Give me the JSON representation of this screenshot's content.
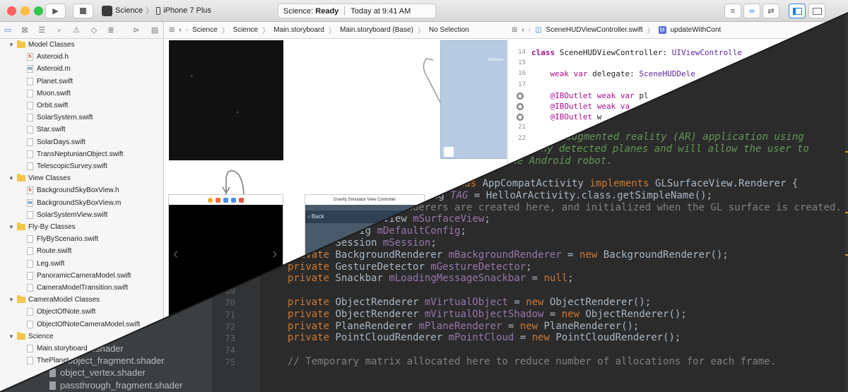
{
  "xcode": {
    "window_controls": {
      "close": "#fc605c",
      "minimize": "#fdbc40",
      "zoom": "#34c84a"
    },
    "scheme": {
      "target": "Science",
      "device": "iPhone 7 Plus",
      "separator": "〉"
    },
    "status": {
      "project": "Science:",
      "state": "Ready",
      "time": "Today at 9:41 AM"
    },
    "navigator": [
      {
        "type": "group",
        "label": "Model Classes"
      },
      {
        "type": "file",
        "kind": "h",
        "label": "Asteroid.h"
      },
      {
        "type": "file",
        "kind": "m",
        "label": "Asteroid.m"
      },
      {
        "type": "file",
        "kind": "swift",
        "label": "Planet.swift"
      },
      {
        "type": "file",
        "kind": "swift",
        "label": "Moon.swift"
      },
      {
        "type": "file",
        "kind": "swift",
        "label": "Orbit.swift"
      },
      {
        "type": "file",
        "kind": "swift",
        "label": "SolarSystem.swift"
      },
      {
        "type": "file",
        "kind": "swift",
        "label": "Star.swift"
      },
      {
        "type": "file",
        "kind": "swift",
        "label": "SolarDays.swift"
      },
      {
        "type": "file",
        "kind": "swift",
        "label": "TransNeptunianObject.swift"
      },
      {
        "type": "file",
        "kind": "swift",
        "label": "TelescopicSurvey.swift"
      },
      {
        "type": "group",
        "label": "View Classes"
      },
      {
        "type": "file",
        "kind": "h",
        "label": "BackgroundSkyBoxView.h"
      },
      {
        "type": "file",
        "kind": "m",
        "label": "BackgroundSkyBoxView.m"
      },
      {
        "type": "file",
        "kind": "swift",
        "label": "SolarSystemView.swift"
      },
      {
        "type": "group",
        "label": "Fly-By Classes"
      },
      {
        "type": "file",
        "kind": "swift",
        "label": "FlyByScenario.swift"
      },
      {
        "type": "file",
        "kind": "swift",
        "label": "Route.swift"
      },
      {
        "type": "file",
        "kind": "swift",
        "label": "Leg.swift"
      },
      {
        "type": "file",
        "kind": "swift",
        "label": "PanoramicCameraModel.swift"
      },
      {
        "type": "file",
        "kind": "swift",
        "label": "CameraModelTransition.swift"
      },
      {
        "type": "group",
        "label": "CameraModel Classes"
      },
      {
        "type": "file",
        "kind": "swift",
        "label": "ObjectOfNote.swift"
      },
      {
        "type": "file",
        "kind": "swift",
        "label": "ObjectOfNoteCameraModel.swift"
      },
      {
        "type": "group",
        "label": "Science"
      },
      {
        "type": "file",
        "kind": "sb",
        "label": "Main.storyboard"
      },
      {
        "type": "file",
        "kind": "swift",
        "label": "ThePlanet"
      }
    ],
    "storyboard_jumpbar": [
      "Science",
      "Science",
      "Main.storyboard",
      "Main.storyboard (Base)",
      "No Selection"
    ],
    "code_jumpbar": [
      "SceneHUDViewController.swift",
      "updateWithCont"
    ],
    "canvas": {
      "scene_label": "SCNView",
      "gravity_title": "Gravity Simulator View Controller",
      "back_label": "Back"
    },
    "code_lines": [
      {
        "num": "14",
        "text": "class SceneHUDViewController: UIViewControlle"
      },
      {
        "num": "15",
        "text": ""
      },
      {
        "num": "16",
        "text": "    weak var delegate: SceneHUDDele"
      },
      {
        "num": "17",
        "text": ""
      },
      {
        "num": "",
        "text": "    @IBOutlet weak var pl"
      },
      {
        "num": "",
        "text": "    @IBOutlet weak va"
      },
      {
        "num": "",
        "text": "    @IBOutlet w"
      },
      {
        "num": "21",
        "text": ""
      },
      {
        "num": "22",
        "text": ""
      }
    ]
  },
  "studio": {
    "project_files": [
      "vertex.shader",
      "object_fragment.shader",
      "object_vertex.shader",
      "passthrough_fragment.shader"
    ],
    "comment_lines": [
      "eate an augmented reality (AR) application using",
      "play any detected planes and will allow the user to",
      "the Android robot."
    ],
    "lines": [
      {
        "num": "",
        "text": "tends AppCompatActivity implements GLSurfaceView.Renderer {"
      },
      {
        "num": "",
        "text": "ring TAG = HelloArActivity.class.getSimpleName();"
      },
      {
        "num": "",
        "text": "The Renderers are created here, and initialized when the GL surface is created."
      },
      {
        "num": "",
        "text": "SurfaceView mSurfaceView;"
      },
      {
        "num": "",
        "text": "private Config mDefaultConfig;"
      },
      {
        "num": "",
        "text": "private Session mSession;"
      },
      {
        "num": "",
        "text": "private BackgroundRenderer mBackgroundRenderer = new BackgroundRenderer();"
      },
      {
        "num": "67",
        "text": "private GestureDetector mGestureDetector;"
      },
      {
        "num": "68",
        "text": "private Snackbar mLoadingMessageSnackbar = null;"
      },
      {
        "num": "69",
        "text": ""
      },
      {
        "num": "70",
        "text": "private ObjectRenderer mVirtualObject = new ObjectRenderer();"
      },
      {
        "num": "71",
        "text": "private ObjectRenderer mVirtualObjectShadow = new ObjectRenderer();"
      },
      {
        "num": "72",
        "text": "private PlaneRenderer mPlaneRenderer = new PlaneRenderer();"
      },
      {
        "num": "73",
        "text": "private PointCloudRenderer mPointCloud = new PointCloudRenderer();"
      },
      {
        "num": "74",
        "text": ""
      },
      {
        "num": "75",
        "text": "// Temporary matrix allocated here to reduce number of allocations for each frame."
      }
    ]
  }
}
